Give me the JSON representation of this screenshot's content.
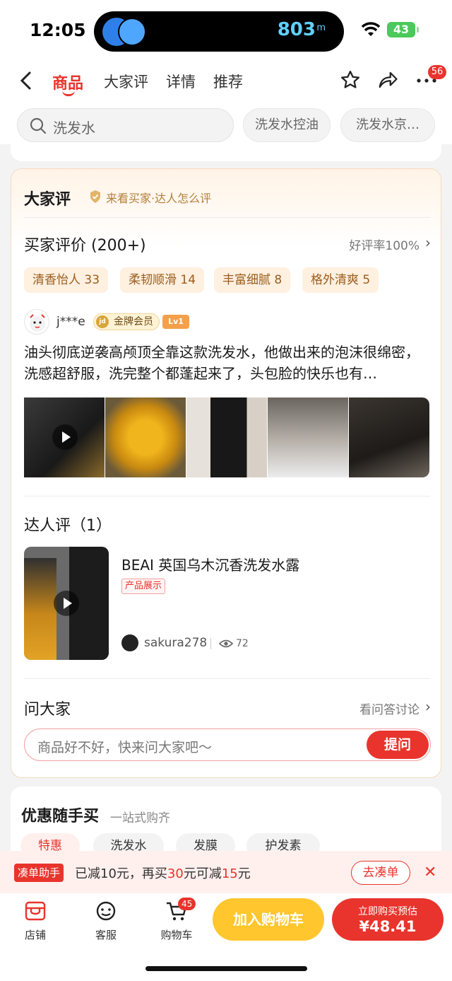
{
  "status_bar": {
    "time": "12:05",
    "island_value": "803",
    "island_unit": "m",
    "battery": "43"
  },
  "nav": {
    "tabs": [
      "商品",
      "大家评",
      "详情",
      "推荐"
    ],
    "more_badge": "56"
  },
  "search": {
    "placeholder": "洗发水",
    "suggestions": [
      "洗发水控油",
      "洗发水京…"
    ]
  },
  "reviews": {
    "title": "大家评",
    "subtitle": "来看买家·达人怎么评",
    "buyer_title": "买家评价 (200+)",
    "good_rate": "好评率100%",
    "tags": [
      "清香怡人 33",
      "柔韧顺滑 14",
      "丰富细腻 8",
      "格外清爽 5"
    ],
    "review": {
      "user": "j***e",
      "badge": "金牌会员",
      "badge_icon_text": "jd",
      "level": "Lv1",
      "text": "油头彻底逆袭高颅顶全靠这款洗发水，他做出来的泡沫很绵密，洗感超舒服，洗完整个都蓬起来了，头包脸的快乐也有…"
    },
    "expert": {
      "title": "达人评（1）",
      "product": "BEAI 英国乌木沉香洗发水露",
      "tag": "产品展示",
      "user": "sakura278",
      "views": "72"
    },
    "qa": {
      "title": "问大家",
      "link": "看问答讨论",
      "placeholder": "商品好不好，快来问大家吧～",
      "button": "提问"
    }
  },
  "promo": {
    "title": "优惠随手买",
    "subtitle": "一站式购齐",
    "tabs": [
      "特惠",
      "洗发水",
      "发膜",
      "护发素"
    ]
  },
  "helper": {
    "tag": "凑单助手",
    "text_a": "已减",
    "amount_a": "10",
    "text_b": "元，再买",
    "amount_b": "30",
    "text_c": "元可减",
    "amount_c": "15",
    "text_d": "元",
    "button": "去凑单"
  },
  "bottom": {
    "store": "店铺",
    "service": "客服",
    "cart": "购物车",
    "cart_badge": "45",
    "add_cart": "加入购物车",
    "buy_label": "立即购买预估",
    "buy_price": "¥48.41"
  },
  "colors": {
    "accent": "#e8342c",
    "gold": "#ffc62e",
    "tag_bg": "#fff0e0"
  }
}
